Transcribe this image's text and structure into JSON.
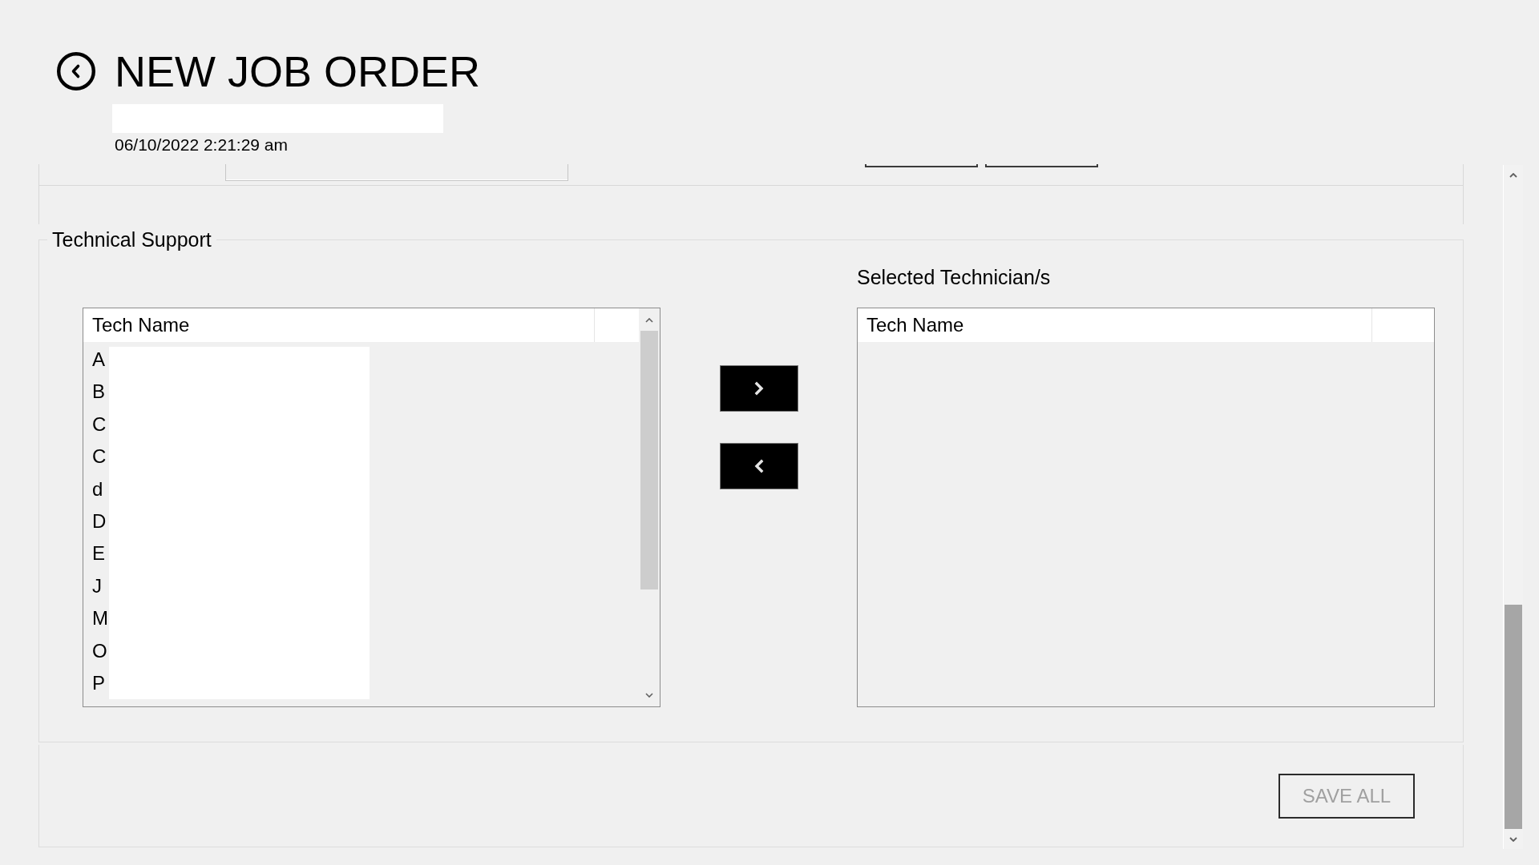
{
  "header": {
    "title": "NEW JOB ORDER",
    "timestamp": "06/10/2022 2:21:29 am"
  },
  "technical_support": {
    "title": "Technical Support",
    "available_list": {
      "columns": [
        "Tech Name"
      ],
      "rows": [
        {
          "text": "A",
          "selected": false
        },
        {
          "text": "B",
          "selected": false
        },
        {
          "text": "C",
          "selected": false
        },
        {
          "text": "C",
          "selected": false
        },
        {
          "text": "d",
          "selected": false
        },
        {
          "text": "D",
          "selected": false
        },
        {
          "text": "E",
          "selected": false
        },
        {
          "text": "J",
          "selected": false
        },
        {
          "text": "M",
          "selected": false
        },
        {
          "text": "O",
          "selected": false
        },
        {
          "text": "P",
          "selected": false
        }
      ]
    },
    "selected_list": {
      "label": "Selected Technician/s",
      "columns": [
        "Tech Name"
      ]
    }
  },
  "save_button": {
    "label": "SAVE ALL",
    "disabled": true
  }
}
